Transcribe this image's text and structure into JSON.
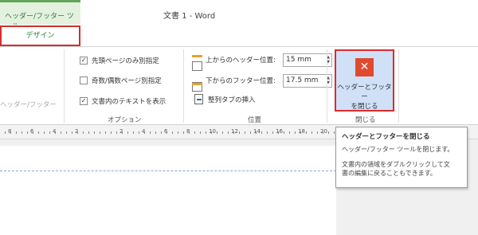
{
  "titlebar": {
    "context_tab": "ヘッダー/フッター ツール",
    "doc_title": "文書 1 - Word"
  },
  "tabs": {
    "design": "デザイン"
  },
  "ribbon": {
    "faded_group_label": "ヘッダー/フッター",
    "options": {
      "items": [
        {
          "label": "先頭ページのみ別指定",
          "checked": true,
          "mark": "✓"
        },
        {
          "label": "奇数/偶数ページ別指定",
          "checked": false,
          "mark": ""
        },
        {
          "label": "文書内のテキストを表示",
          "checked": true,
          "mark": "✓"
        }
      ],
      "group_label": "オプション"
    },
    "position": {
      "header_label": "上からのヘッダー位置:",
      "header_value": "15 mm",
      "footer_label": "下からのフッター位置:",
      "footer_value": "17.5 mm",
      "align_tab_label": "整列タブの挿入",
      "group_label": "位置"
    },
    "close": {
      "button_label_1": "ヘッダーとフッター",
      "button_label_2": "を閉じる",
      "group_label": "閉じる",
      "accent": "#e04a2f"
    }
  },
  "ruler": {
    "numbers": [
      "8",
      "6",
      "4",
      "2",
      "",
      "2",
      "4",
      "6",
      "8",
      "10",
      "12",
      "14",
      "16",
      "18",
      "20",
      "22",
      "",
      "",
      "",
      "36"
    ]
  },
  "tooltip": {
    "title": "ヘッダーとフッターを閉じる",
    "line1": "ヘッダー/フッター ツールを閉じます。",
    "line2": "文書内の領域をダブルクリックして文",
    "line3": "書の編集に戻ることもできます。"
  }
}
